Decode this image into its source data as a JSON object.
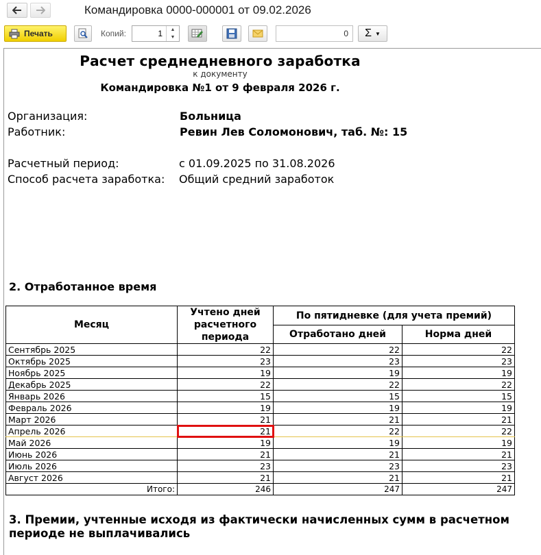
{
  "window": {
    "title": "Командировка 0000-000001 от 09.02.2026"
  },
  "toolbar": {
    "print_label": "Печать",
    "copies_label": "Копий:",
    "copies_value": "1",
    "number_value": "0",
    "sum_label": "Σ"
  },
  "report": {
    "title": "Расчет среднедневного заработка",
    "subtitle": "к документу",
    "document_ref": "Командировка №1 от 9 февраля 2026 г.",
    "org_label": "Организация:",
    "org_value": "Больница",
    "worker_label": "Работник:",
    "worker_value": "Ревин Лев Соломонович, таб. №: 15",
    "period_label": "Расчетный период:",
    "period_value": "с 01.09.2025 по 31.08.2026",
    "method_label": "Способ расчета заработка:",
    "method_value": "Общий средний заработок",
    "section2_title": "2. Отработанное время",
    "section3_title_line1": "3. Премии, учтенные исходя из фактически начисленных сумм в расчетном",
    "section3_title_line2": "периоде не выплачивались"
  },
  "table": {
    "col_month": "Месяц",
    "col_days_l1": "Учтено дней",
    "col_days_l2": "расчетного",
    "col_days_l3": "периода",
    "col_group": "По пятидневке (для учета премий)",
    "col_worked": "Отработано дней",
    "col_norm": "Норма дней",
    "rows": [
      {
        "month": "Сентябрь 2025",
        "days": "22",
        "worked": "22",
        "norm": "22"
      },
      {
        "month": "Октябрь 2025",
        "days": "23",
        "worked": "23",
        "norm": "23"
      },
      {
        "month": "Ноябрь 2025",
        "days": "19",
        "worked": "19",
        "norm": "19"
      },
      {
        "month": "Декабрь 2025",
        "days": "22",
        "worked": "22",
        "norm": "22"
      },
      {
        "month": "Январь 2026",
        "days": "15",
        "worked": "15",
        "norm": "15"
      },
      {
        "month": "Февраль 2026",
        "days": "19",
        "worked": "19",
        "norm": "19"
      },
      {
        "month": "Март 2026",
        "days": "21",
        "worked": "21",
        "norm": "21"
      },
      {
        "month": "Апрель 2026",
        "days": "21",
        "worked": "22",
        "norm": "22"
      },
      {
        "month": "Май 2026",
        "days": "19",
        "worked": "19",
        "norm": "19"
      },
      {
        "month": "Июнь 2026",
        "days": "21",
        "worked": "21",
        "norm": "21"
      },
      {
        "month": "Июль 2026",
        "days": "23",
        "worked": "23",
        "norm": "23"
      },
      {
        "month": "Август 2026",
        "days": "21",
        "worked": "21",
        "norm": "21"
      }
    ],
    "total_label": "Итого:",
    "total_days": "246",
    "total_worked": "247",
    "total_norm": "247"
  },
  "icons": {
    "back": "arrow-left-icon",
    "forward": "arrow-right-icon",
    "print": "printer-icon",
    "preview": "magnifier-icon",
    "edit": "edit-table-icon",
    "save": "floppy-disk-icon",
    "mail": "envelope-icon"
  },
  "colors": {
    "print_button": "#f0cf00",
    "selection": "#e01010",
    "row_highlight": "#e5c34a"
  }
}
